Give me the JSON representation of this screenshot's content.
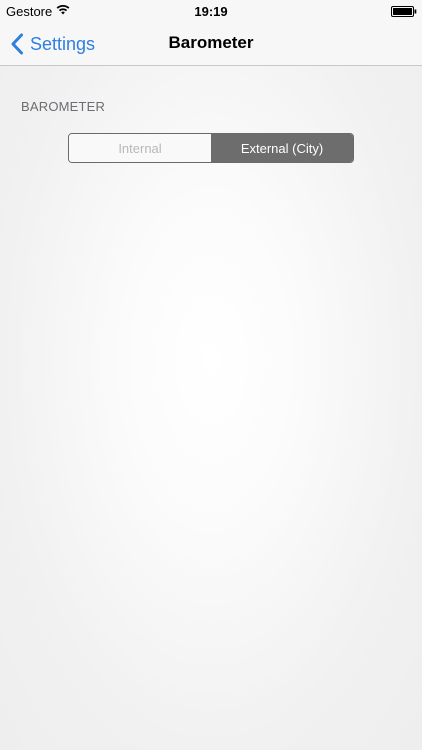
{
  "status_bar": {
    "carrier": "Gestore",
    "time": "19:19",
    "wifi_icon": "wifi-icon",
    "battery_icon": "battery-icon"
  },
  "nav_bar": {
    "back_label": "Settings",
    "back_icon": "chevron-left-icon",
    "title": "Barometer",
    "accent_color": "#2d7fe0"
  },
  "section": {
    "header": "BAROMETER"
  },
  "segmented_control": {
    "options": [
      {
        "label": "Internal",
        "selected": false
      },
      {
        "label": "External (City)",
        "selected": true
      }
    ],
    "selected_color": "#6d6d6d"
  }
}
